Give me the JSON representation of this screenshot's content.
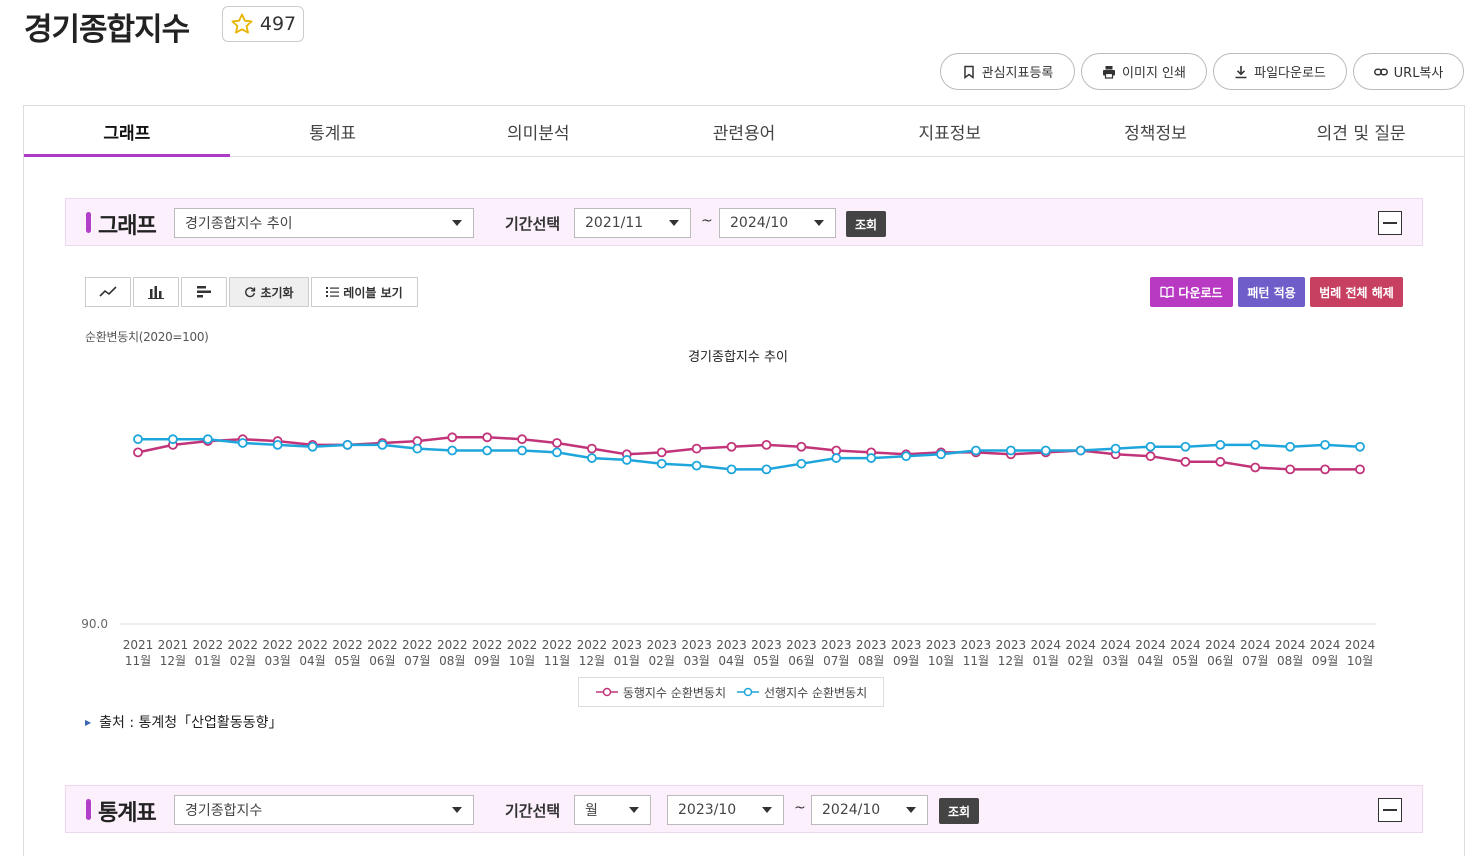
{
  "page": {
    "title": "경기종합지수",
    "favorite_count": "497",
    "actions": [
      "관심지표등록",
      "이미지 인쇄",
      "파일다운로드",
      "URL복사"
    ],
    "tabs": [
      "그래프",
      "통계표",
      "의미분석",
      "관련용어",
      "지표정보",
      "정책정보",
      "의견 및 질문"
    ]
  },
  "graph_panel": {
    "heading": "그래프",
    "dataset": "경기종합지수 추이",
    "period_label": "기간선택",
    "from": "2021/11",
    "tilde": "~",
    "to": "2024/10",
    "query": "조회",
    "toolbar": {
      "reset": "초기화",
      "labels": "레이블 보기"
    },
    "buttons": {
      "download": "다운로드",
      "pattern": "패턴 적용",
      "legend_off": "범례 전체 해제"
    },
    "colors": {
      "download": "#b93ac2",
      "pattern": "#6f5dc9",
      "legend_off": "#c74061"
    },
    "source_label": "출처 : 통계청「산업활동동향」"
  },
  "table_panel": {
    "heading": "통계표",
    "dataset": "경기종합지수",
    "period_label": "기간선택",
    "unit": "월",
    "from": "2023/10",
    "tilde": "~",
    "to": "2024/10",
    "query": "조회"
  },
  "chart_data": {
    "type": "line",
    "title": "경기종합지수 추이",
    "ylabel": "순환변동치(2020=100)",
    "y_tick_label": "90.0",
    "ylim": [
      90.0,
      104.0
    ],
    "grid": false,
    "legend_position": "bottom",
    "categories": [
      [
        "2021",
        "11월"
      ],
      [
        "2021",
        "12월"
      ],
      [
        "2022",
        "01월"
      ],
      [
        "2022",
        "02월"
      ],
      [
        "2022",
        "03월"
      ],
      [
        "2022",
        "04월"
      ],
      [
        "2022",
        "05월"
      ],
      [
        "2022",
        "06월"
      ],
      [
        "2022",
        "07월"
      ],
      [
        "2022",
        "08월"
      ],
      [
        "2022",
        "09월"
      ],
      [
        "2022",
        "10월"
      ],
      [
        "2022",
        "11월"
      ],
      [
        "2022",
        "12월"
      ],
      [
        "2023",
        "01월"
      ],
      [
        "2023",
        "02월"
      ],
      [
        "2023",
        "03월"
      ],
      [
        "2023",
        "04월"
      ],
      [
        "2023",
        "05월"
      ],
      [
        "2023",
        "06월"
      ],
      [
        "2023",
        "07월"
      ],
      [
        "2023",
        "08월"
      ],
      [
        "2023",
        "09월"
      ],
      [
        "2023",
        "10월"
      ],
      [
        "2023",
        "11월"
      ],
      [
        "2023",
        "12월"
      ],
      [
        "2024",
        "01월"
      ],
      [
        "2024",
        "02월"
      ],
      [
        "2024",
        "03월"
      ],
      [
        "2024",
        "04월"
      ],
      [
        "2024",
        "05월"
      ],
      [
        "2024",
        "06월"
      ],
      [
        "2024",
        "07월"
      ],
      [
        "2024",
        "08월"
      ],
      [
        "2024",
        "09월"
      ],
      [
        "2024",
        "10월"
      ]
    ],
    "series": [
      {
        "name": "동행지수 순환변동치",
        "color": "#c2347a",
        "values": [
          99.1,
          99.5,
          99.7,
          99.8,
          99.7,
          99.5,
          99.5,
          99.6,
          99.7,
          99.9,
          99.9,
          99.8,
          99.6,
          99.3,
          99.0,
          99.1,
          99.3,
          99.4,
          99.5,
          99.4,
          99.2,
          99.1,
          99.0,
          99.1,
          99.1,
          99.0,
          99.1,
          99.2,
          99.0,
          98.9,
          98.6,
          98.6,
          98.3,
          98.2,
          98.2,
          98.2
        ]
      },
      {
        "name": "선행지수 순환변동치",
        "color": "#1ea6dc",
        "values": [
          99.8,
          99.8,
          99.8,
          99.6,
          99.5,
          99.4,
          99.5,
          99.5,
          99.3,
          99.2,
          99.2,
          99.2,
          99.1,
          98.8,
          98.7,
          98.5,
          98.4,
          98.2,
          98.2,
          98.5,
          98.8,
          98.8,
          98.9,
          99.0,
          99.2,
          99.2,
          99.2,
          99.2,
          99.3,
          99.4,
          99.4,
          99.5,
          99.5,
          99.4,
          99.5,
          99.4
        ]
      }
    ]
  }
}
